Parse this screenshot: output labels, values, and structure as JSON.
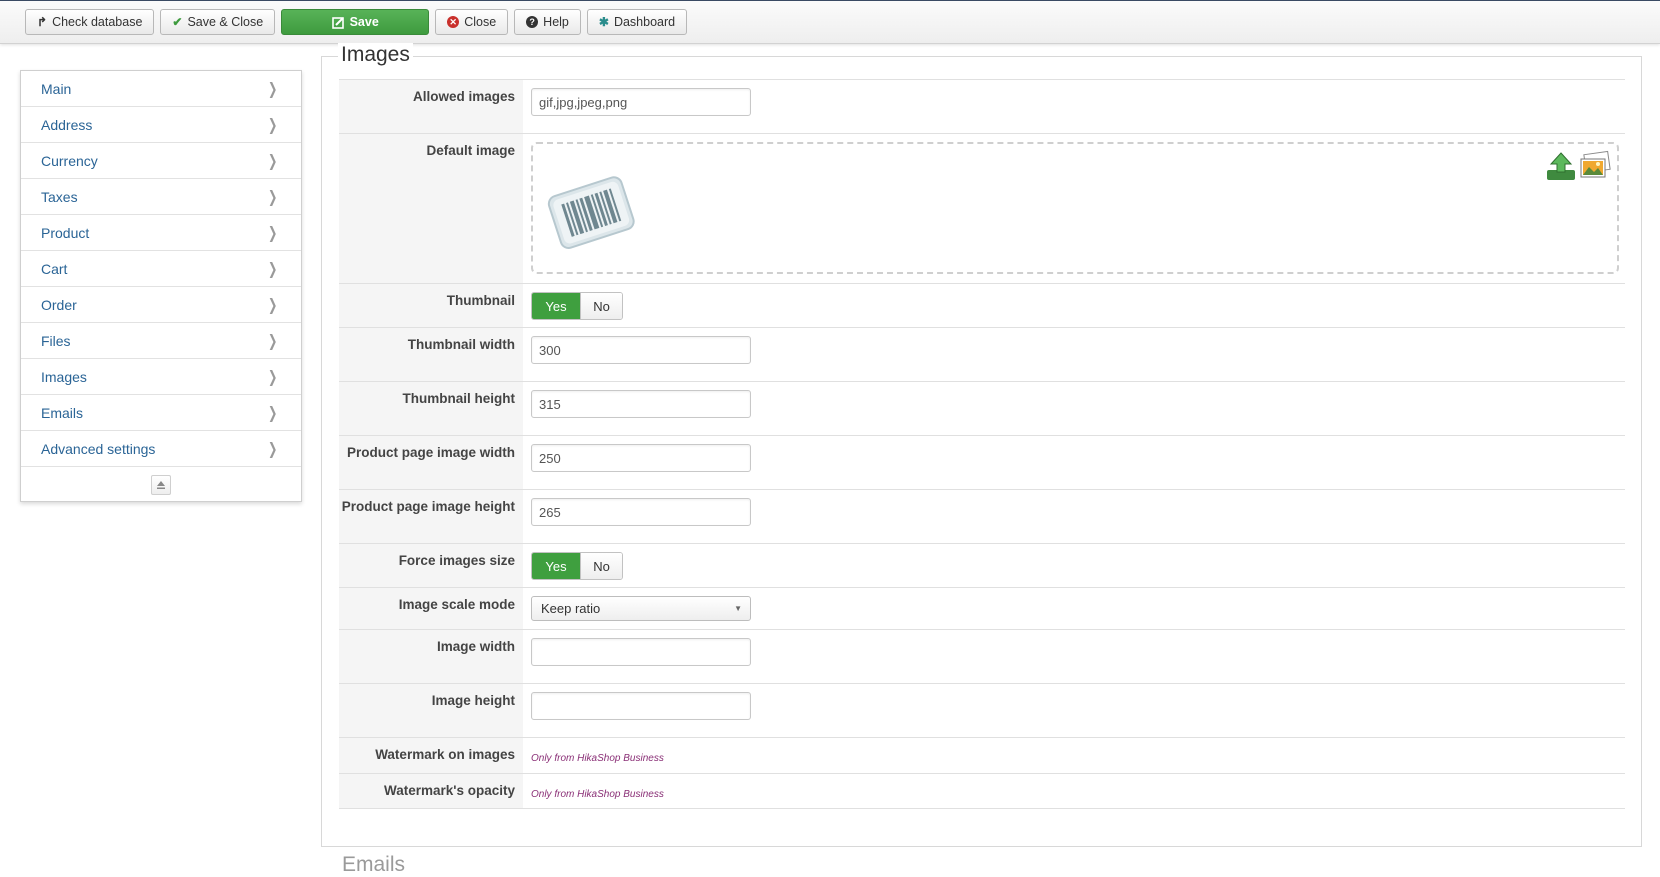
{
  "toolbar": {
    "check_database": "Check database",
    "save_close": "Save & Close",
    "save": "Save",
    "close": "Close",
    "help": "Help",
    "dashboard": "Dashboard"
  },
  "sidebar": {
    "items": [
      {
        "label": "Main"
      },
      {
        "label": "Address"
      },
      {
        "label": "Currency"
      },
      {
        "label": "Taxes"
      },
      {
        "label": "Product"
      },
      {
        "label": "Cart"
      },
      {
        "label": "Order"
      },
      {
        "label": "Files"
      },
      {
        "label": "Images"
      },
      {
        "label": "Emails"
      },
      {
        "label": "Advanced settings"
      }
    ]
  },
  "section": {
    "title": "Images",
    "next_title": "Emails"
  },
  "fields": {
    "allowed_images": {
      "label": "Allowed images",
      "value": "gif,jpg,jpeg,png"
    },
    "default_image": {
      "label": "Default image"
    },
    "thumbnail": {
      "label": "Thumbnail",
      "yes": "Yes",
      "no": "No",
      "selected": "Yes"
    },
    "thumbnail_width": {
      "label": "Thumbnail width",
      "value": "300"
    },
    "thumbnail_height": {
      "label": "Thumbnail height",
      "value": "315"
    },
    "product_page_image_width": {
      "label": "Product page image width",
      "value": "250"
    },
    "product_page_image_height": {
      "label": "Product page image height",
      "value": "265"
    },
    "force_images_size": {
      "label": "Force images size",
      "yes": "Yes",
      "no": "No",
      "selected": "Yes"
    },
    "image_scale_mode": {
      "label": "Image scale mode",
      "value": "Keep ratio"
    },
    "image_width": {
      "label": "Image width",
      "value": ""
    },
    "image_height": {
      "label": "Image height",
      "value": ""
    },
    "watermark_on_images": {
      "label": "Watermark on images",
      "note": "Only from HikaShop Business"
    },
    "watermark_opacity": {
      "label": "Watermark's opacity",
      "note": "Only from HikaShop Business"
    }
  },
  "colors": {
    "save_green": "#3e9b3e",
    "toggle_on": "#3f9f3f",
    "link_blue": "#2a6496",
    "business_note": "#8a2f76"
  },
  "icons": {
    "check_database": "database-icon",
    "save_close": "check-icon",
    "save": "edit-icon",
    "close": "close-circle-icon",
    "help": "question-circle-icon",
    "dashboard": "asterisk-icon"
  }
}
